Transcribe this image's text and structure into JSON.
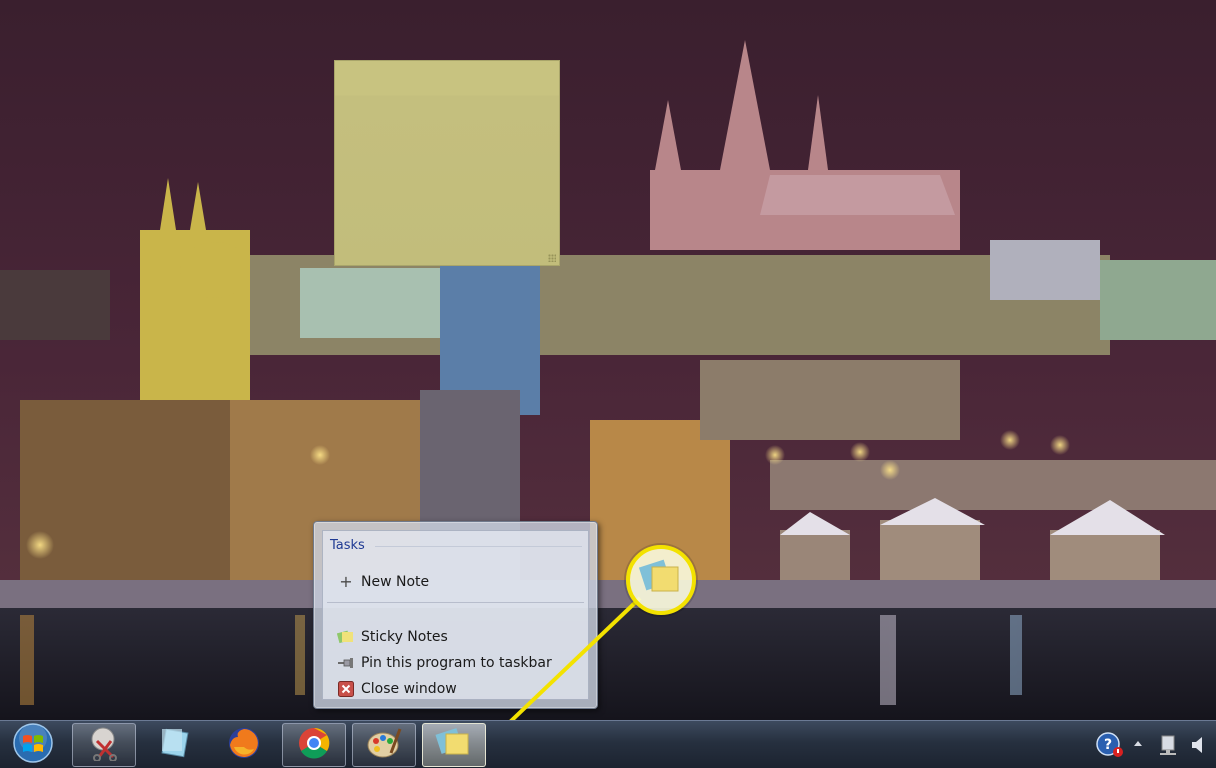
{
  "jump_list": {
    "header": "Tasks",
    "tasks": [
      {
        "label": "New Note",
        "icon": "plus-icon"
      }
    ],
    "items": [
      {
        "label": "Sticky Notes",
        "icon": "sticky-notes-icon"
      },
      {
        "label": "Pin this program to taskbar",
        "icon": "pin-icon"
      },
      {
        "label": "Close window",
        "icon": "close-window-icon"
      }
    ]
  },
  "taskbar": {
    "start_icon": "windows-start-orb-icon",
    "buttons": [
      {
        "app": "Snipping Tool",
        "icon": "snipping-tool-icon"
      },
      {
        "app": "Sticky Notes (pinned)",
        "icon": "sticky-notes-pinned-icon"
      },
      {
        "app": "Firefox",
        "icon": "firefox-icon"
      },
      {
        "app": "Chrome",
        "icon": "chrome-icon"
      },
      {
        "app": "Paint",
        "icon": "paint-icon"
      },
      {
        "app": "Sticky Notes",
        "icon": "sticky-notes-icon",
        "active": true
      }
    ],
    "tray": [
      "help-icon",
      "show-hidden-icons-arrow",
      "network-icon",
      "volume-icon"
    ]
  },
  "colors": {
    "callout": "#f3e200",
    "sticky_note": "#c8c380",
    "jump_list_header": "#1f3a93"
  }
}
